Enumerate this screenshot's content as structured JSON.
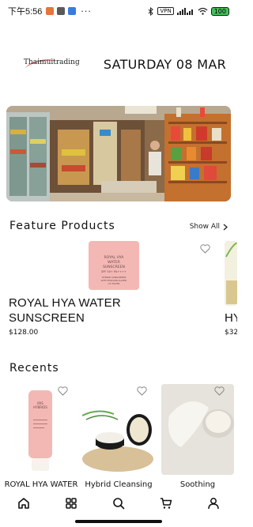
{
  "status_bar": {
    "time": "下午5:56",
    "more": "···",
    "vpn": "VPN",
    "battery": "100"
  },
  "header": {
    "logo_text": "Thaimuitrading",
    "date": "SATURDAY 08 MAR"
  },
  "featured": {
    "title": "Feature Products",
    "show_all": "Show All",
    "items": [
      {
        "name": "ROYAL HYA WATER SUNSCREEN",
        "price": "$128.00",
        "tube_text": [
          "ROYAL HYA",
          "WATER",
          "SUNSCREEN",
          "SPF 50+ PA++++",
          "HYBRID SUNSCREEN",
          "WITH ENCAPSULATED",
          "UV FILTER"
        ]
      },
      {
        "name_partial": "HY",
        "price_partial": "$32"
      }
    ]
  },
  "recents": {
    "title": "Recents",
    "items": [
      {
        "name": "ROYAL HYA WATER",
        "tube_text": "IRIS HYBRIDS"
      },
      {
        "name": "Hybrid Cleansing"
      },
      {
        "name": "Soothing"
      }
    ]
  },
  "nav": {
    "items": [
      {
        "icon": "home-icon"
      },
      {
        "icon": "grid-icon"
      },
      {
        "icon": "search-icon"
      },
      {
        "icon": "cart-icon"
      },
      {
        "icon": "profile-icon"
      }
    ]
  },
  "colors": {
    "tube_pink": "#f4b8b4",
    "battery_green": "#44c05a",
    "accent_dark": "#111111"
  }
}
